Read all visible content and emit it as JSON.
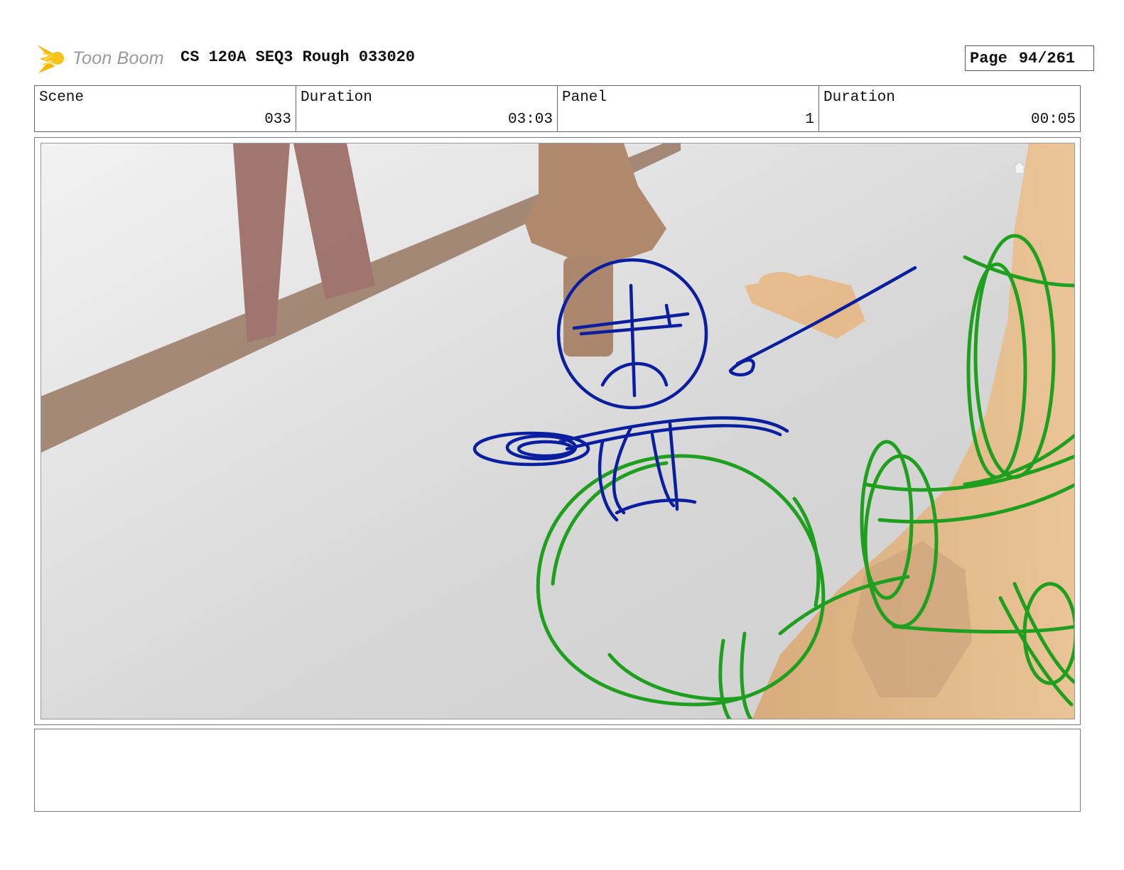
{
  "header": {
    "brand": "Toon Boom",
    "title": "CS 120A SEQ3 Rough 033020",
    "page_label": "Page",
    "page_value": "94/261"
  },
  "info": {
    "scene_label": "Scene",
    "scene_value": "033",
    "scene_duration_label": "Duration",
    "scene_duration_value": "03:03",
    "panel_label": "Panel",
    "panel_value": "1",
    "panel_duration_label": "Duration",
    "panel_duration_value": "00:05"
  },
  "notes": {
    "text": ""
  },
  "colors": {
    "sketch_blue": "#0a1ea0",
    "sketch_green": "#1ea01e",
    "character_orange": "#e8b680",
    "furniture_brown": "#8a5a3c",
    "logo_yellow": "#f5b800"
  },
  "icons": {
    "logo": "toon-boom-star-icon",
    "home": "home-icon"
  }
}
